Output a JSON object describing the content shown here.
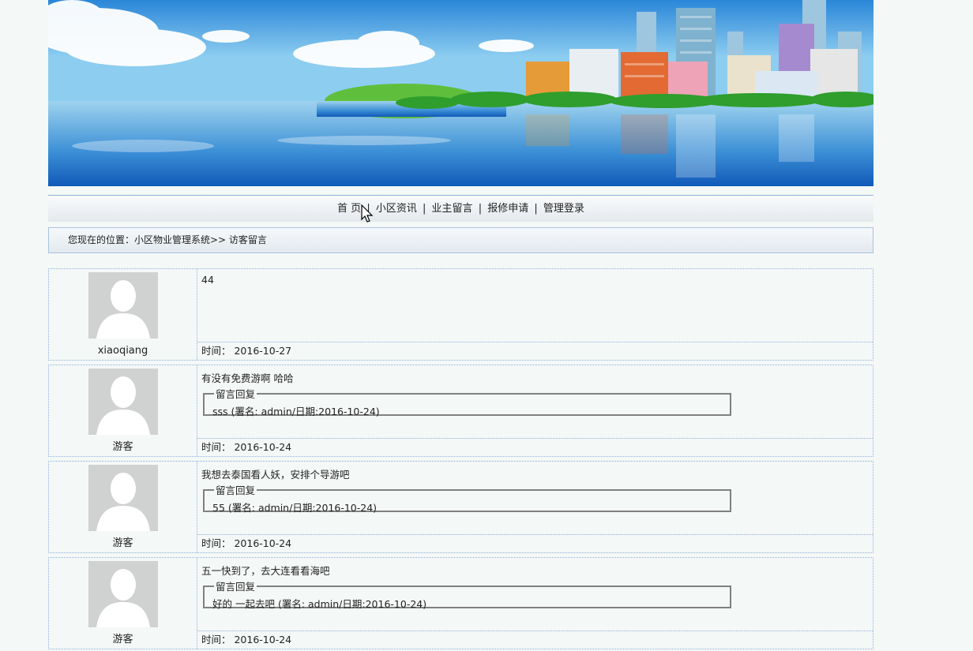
{
  "nav": {
    "items": [
      {
        "label": "首 页"
      },
      {
        "label": "小区资讯"
      },
      {
        "label": "业主留言"
      },
      {
        "label": "报修申请"
      },
      {
        "label": "管理登录"
      }
    ],
    "separator": "|"
  },
  "breadcrumb": {
    "text": "您现在的位置：小区物业管理系统>> 访客留言"
  },
  "messages": [
    {
      "user": "xiaoqiang",
      "content": "44",
      "time": "时间： 2016-10-27"
    },
    {
      "user": "游客",
      "content": "有没有免费游啊 哈哈",
      "reply_title": "留言回复",
      "reply": "sss (署名: admin/日期:2016-10-24)",
      "time": "时间： 2016-10-24"
    },
    {
      "user": "游客",
      "content": "我想去泰国看人妖，安排个导游吧",
      "reply_title": "留言回复",
      "reply": "55 (署名: admin/日期:2016-10-24)",
      "time": "时间： 2016-10-24"
    },
    {
      "user": "游客",
      "content": "五一快到了，去大连看看海吧",
      "reply_title": "留言回复",
      "reply": "好的 一起去吧 (署名: admin/日期:2016-10-24)",
      "time": "时间： 2016-10-24"
    }
  ],
  "colors": {
    "border": "#8fb0e0",
    "page_bg": "#f4f8f6"
  }
}
